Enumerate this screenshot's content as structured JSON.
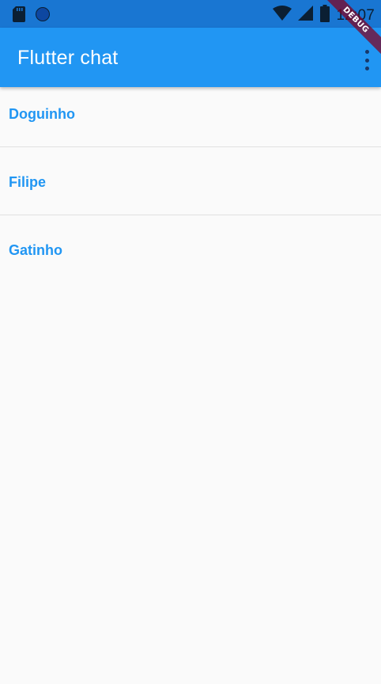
{
  "status_bar": {
    "time": "12:07",
    "icons": [
      "sd-card-icon",
      "circle-notification-icon",
      "wifi-icon",
      "cell-signal-icon",
      "battery-icon"
    ]
  },
  "app_bar": {
    "title": "Flutter chat",
    "overflow_icon": "more-vert-icon"
  },
  "debug_banner": {
    "label": "DEBUG"
  },
  "chats": [
    {
      "name": "Doguinho"
    },
    {
      "name": "Filipe"
    },
    {
      "name": "Gatinho"
    }
  ],
  "colors": {
    "primary": "#2196f3",
    "primary_dark": "#1976d2",
    "background": "#fafafa",
    "divider": "#e0e0e0",
    "debug_ribbon": "#800020"
  }
}
